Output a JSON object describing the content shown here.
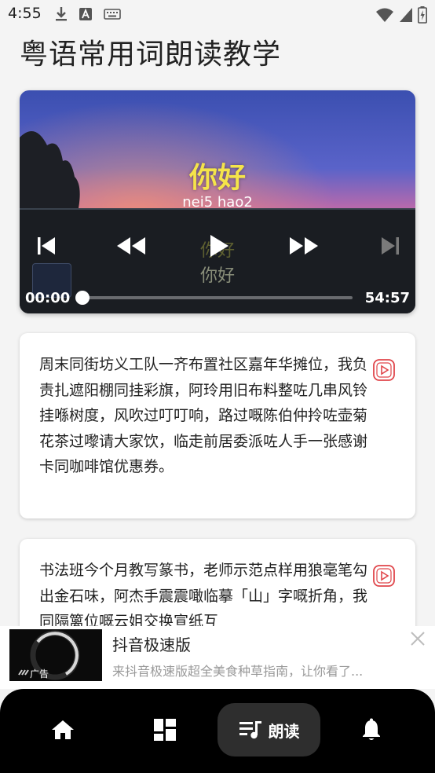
{
  "status": {
    "time": "4:55",
    "left_icons": [
      "download-icon",
      "text-a-icon",
      "keyboard-icon"
    ],
    "right_icons": [
      "wifi-icon",
      "signal-icon",
      "battery-icon"
    ]
  },
  "page": {
    "title": "粤语常用词朗读教学"
  },
  "player": {
    "word": "你好",
    "romanization": "nei5 hao2",
    "ghost_word": "你好",
    "sub_word": "你好",
    "time_current": "00:00",
    "time_total": "54:57",
    "progress": 0.0
  },
  "cards": [
    {
      "text": "周末同街坊义工队一齐布置社区嘉年华摊位，我负责扎遮阳棚同挂彩旗，阿玲用旧布料整咗几串风铃挂喺树度，风吹过叮叮响，路过嘅陈伯仲拎咗壶菊花茶过嚟请大家饮，临走前居委派咗人手一张感谢卡同咖啡馆优惠券。"
    },
    {
      "text": "书法班今个月教写篆书，老师示范点样用狼毫笔勾出金石味，阿杰手震震噉临摹「山」字嘅折角，我同隔篱位嘅云姐交换宣纸互"
    }
  ],
  "ad": {
    "tag": "广告",
    "title": "抖音极速版",
    "description": "来抖音极速版超全美食种草指南，让你看了..."
  },
  "nav": {
    "active_label": "朗读"
  },
  "colors": {
    "accent_red": "#e0464b",
    "word_yellow": "#f5e44a",
    "nav_bg": "#000000",
    "nav_active_bg": "#2e2e2e"
  }
}
